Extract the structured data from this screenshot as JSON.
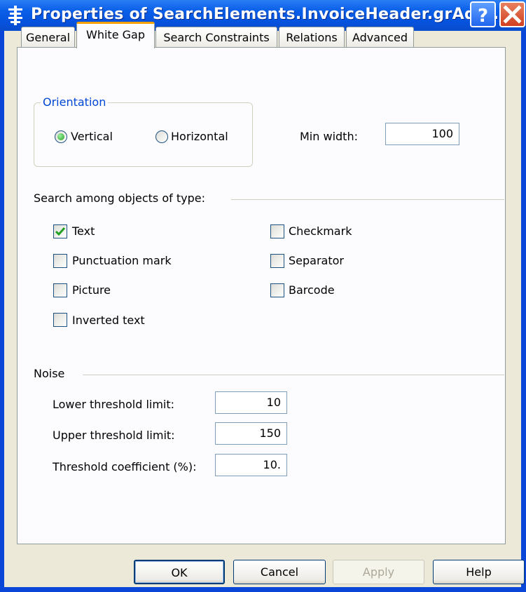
{
  "window": {
    "title": "Properties of SearchElements.InvoiceHeader.grAdd..."
  },
  "titlebar": {
    "help_icon": "question-mark-icon",
    "close_icon": "close-x-icon"
  },
  "tabs": [
    {
      "label": "General"
    },
    {
      "label": "White Gap",
      "active": true
    },
    {
      "label": "Search Constraints"
    },
    {
      "label": "Relations"
    },
    {
      "label": "Advanced"
    }
  ],
  "orientation": {
    "group_label": "Orientation",
    "vertical_label": "Vertical",
    "horizontal_label": "Horizontal",
    "selected": "Vertical"
  },
  "min_width": {
    "label": "Min width:",
    "value": "100"
  },
  "search_types": {
    "label": "Search among objects of type:",
    "items": [
      {
        "label": "Text",
        "checked": true
      },
      {
        "label": "Punctuation mark",
        "checked": false
      },
      {
        "label": "Picture",
        "checked": false
      },
      {
        "label": "Inverted text",
        "checked": false
      },
      {
        "label": "Checkmark",
        "checked": false
      },
      {
        "label": "Separator",
        "checked": false
      },
      {
        "label": "Barcode",
        "checked": false
      }
    ]
  },
  "noise": {
    "label": "Noise",
    "lower": {
      "label": "Lower threshold limit:",
      "value": "10"
    },
    "upper": {
      "label": "Upper threshold limit:",
      "value": "150"
    },
    "coef": {
      "label": "Threshold coefficient (%):",
      "value": "10."
    }
  },
  "buttons": {
    "ok": "OK",
    "cancel": "Cancel",
    "apply": "Apply",
    "help": "Help"
  },
  "colors": {
    "titlebar": "#0a5fe8",
    "group_title": "#0046d5",
    "active_tab_accent": "#f5a200",
    "dialog_bg": "#ece9d8"
  }
}
